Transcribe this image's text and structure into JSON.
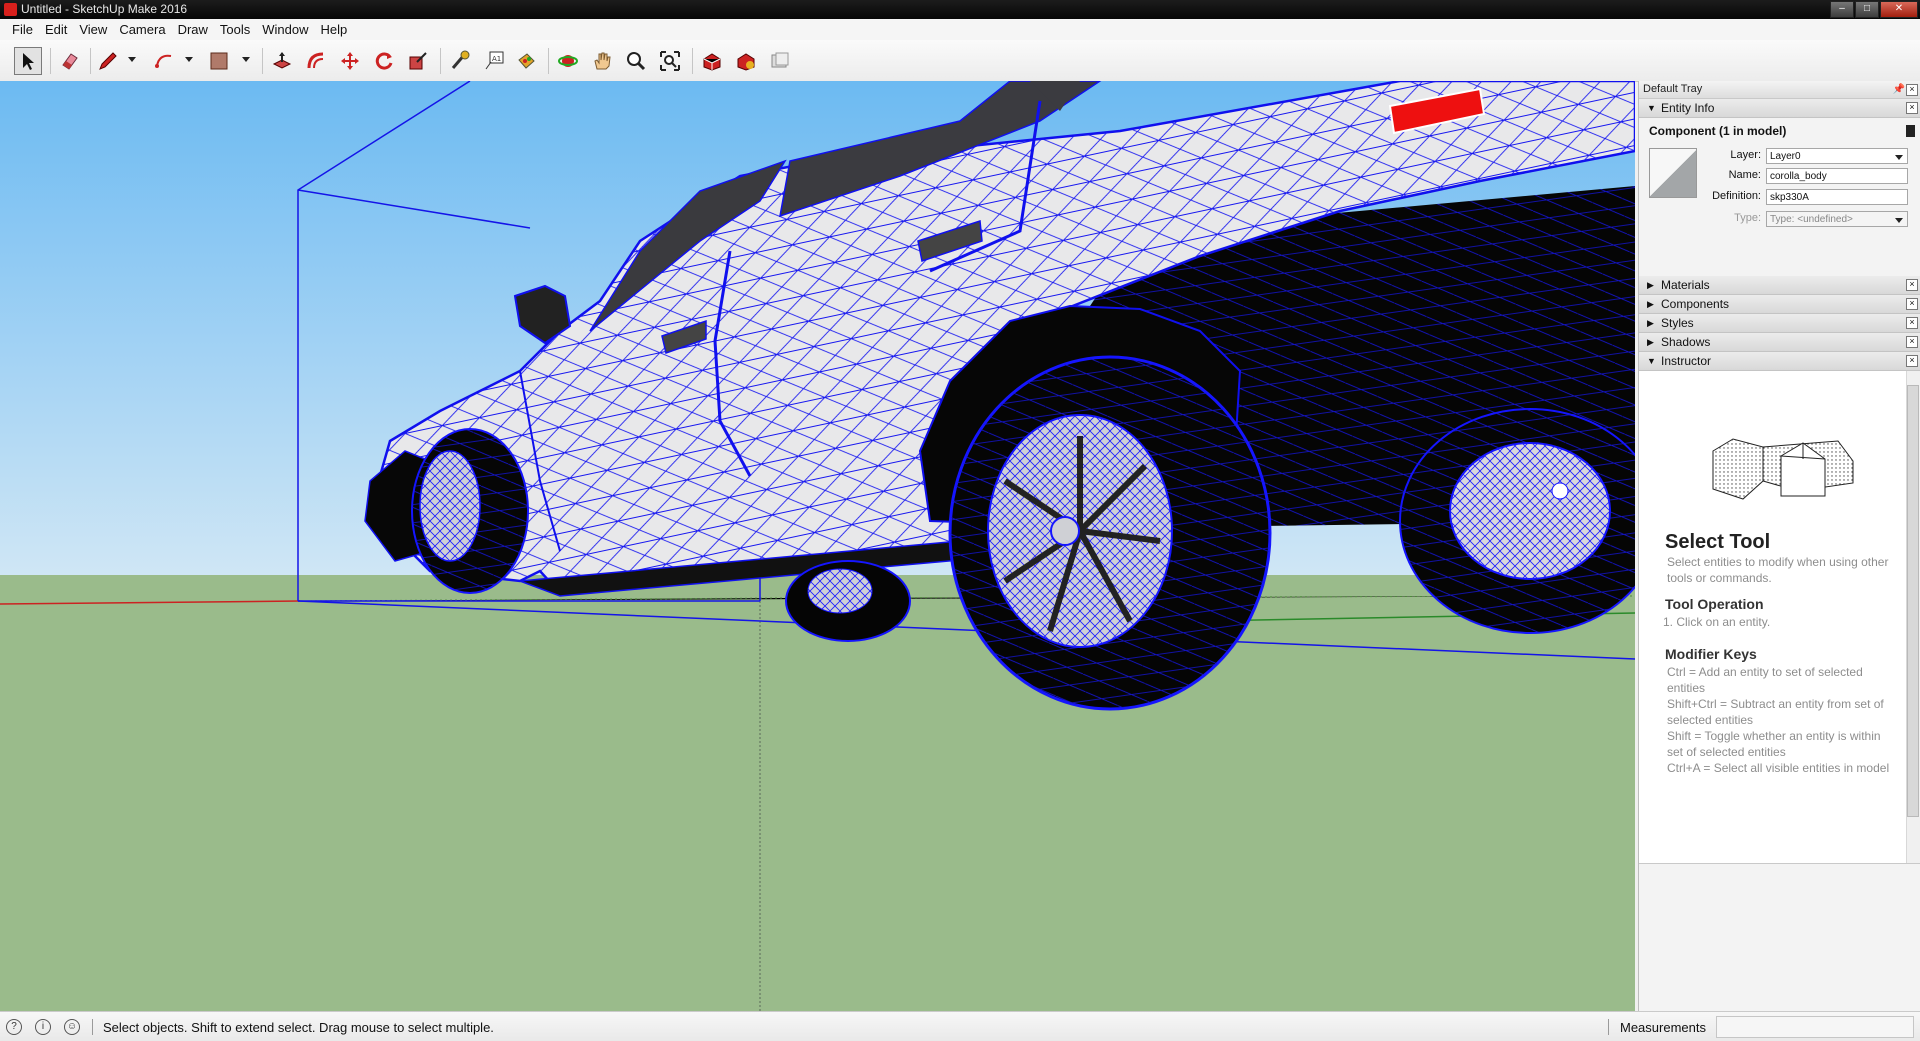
{
  "window": {
    "title": "Untitled - SketchUp Make 2016",
    "controls": [
      "–",
      "□",
      "✕"
    ]
  },
  "menu": [
    "File",
    "Edit",
    "View",
    "Camera",
    "Draw",
    "Tools",
    "Window",
    "Help"
  ],
  "toolbar": {
    "tools": [
      {
        "name": "select-tool",
        "icon": "arrow-cursor-icon",
        "active": true
      },
      {
        "name": "eraser-tool",
        "icon": "eraser-icon"
      },
      {
        "name": "line-tool",
        "icon": "pencil-icon",
        "dropdown": true
      },
      {
        "name": "arc-tool",
        "icon": "arc-icon",
        "dropdown": true
      },
      {
        "name": "rectangle-tool",
        "icon": "rectangle-icon",
        "dropdown": true
      },
      {
        "name": "push-pull-tool",
        "icon": "push-pull-icon"
      },
      {
        "name": "offset-tool",
        "icon": "offset-icon"
      },
      {
        "name": "move-tool",
        "icon": "move-icon"
      },
      {
        "name": "rotate-tool",
        "icon": "rotate-icon"
      },
      {
        "name": "scale-tool",
        "icon": "scale-icon"
      },
      {
        "name": "tape-measure-tool",
        "icon": "tape-measure-icon"
      },
      {
        "name": "text-tool",
        "icon": "text-icon"
      },
      {
        "name": "paint-bucket-tool",
        "icon": "paint-bucket-icon"
      },
      {
        "name": "orbit-tool",
        "icon": "orbit-icon"
      },
      {
        "name": "pan-tool",
        "icon": "pan-hand-icon"
      },
      {
        "name": "zoom-tool",
        "icon": "zoom-icon"
      },
      {
        "name": "zoom-extents-tool",
        "icon": "zoom-extents-icon"
      },
      {
        "name": "warehouse-tool",
        "icon": "warehouse-icon"
      },
      {
        "name": "extension-warehouse-tool",
        "icon": "extension-warehouse-icon"
      },
      {
        "name": "send-to-layout-tool",
        "icon": "layout-icon"
      }
    ]
  },
  "colors": {
    "sky": "#7cc3f3",
    "ground": "#9abb8b",
    "wire": "#1010ee",
    "body": "#e8e8ea",
    "tire": "#0a0a0a",
    "tail_light": "#ee1010",
    "axis_red": "#cc2222",
    "axis_green": "#22aa22"
  },
  "tray": {
    "title": "Default Tray",
    "entity_info": {
      "header": "Entity Info",
      "component_title": "Component (1 in model)",
      "layer_label": "Layer:",
      "layer_value": "Layer0",
      "name_label": "Name:",
      "name_value": "corolla_body",
      "definition_label": "Definition:",
      "definition_value": "skp330A",
      "type_label": "Type:",
      "type_value": "Type: <undefined>"
    },
    "panels": [
      "Materials",
      "Components",
      "Styles",
      "Shadows"
    ],
    "instructor": {
      "header": "Instructor",
      "title": "Select Tool",
      "intro": "Select entities to modify when using other tools or commands.",
      "op_heading": "Tool Operation",
      "op_step": "1.   Click on an entity.",
      "mod_heading": "Modifier Keys",
      "mod_lines": [
        "Ctrl = Add an entity to set of selected entities",
        "Shift+Ctrl = Subtract an entity from set of selected entities",
        "Shift = Toggle whether an entity is within set of selected entities",
        "Ctrl+A = Select all visible entities in model"
      ]
    }
  },
  "status": {
    "hint": "Select objects. Shift to extend select. Drag mouse to select multiple.",
    "measurements_label": "Measurements",
    "measurements_value": ""
  }
}
